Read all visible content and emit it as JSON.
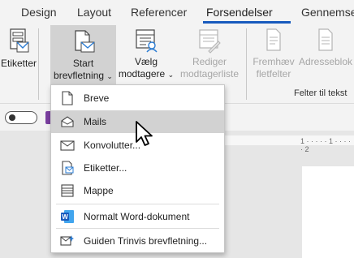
{
  "tabs": [
    {
      "label": "Design"
    },
    {
      "label": "Layout"
    },
    {
      "label": "Referencer"
    },
    {
      "label": "Forsendelser",
      "active": true
    },
    {
      "label": "Gennemse"
    }
  ],
  "ribbon": {
    "etiketter": {
      "line1": "Etiketter",
      "icon": "label-sheet-icon"
    },
    "start": {
      "line1": "Start",
      "line2": "brevfletning",
      "icon": "start-mail-merge-icon"
    },
    "vaelg": {
      "line1": "Vælg",
      "line2": "modtagere",
      "icon": "select-recipients-icon"
    },
    "rediger": {
      "line1": "Rediger",
      "line2": "modtagerliste",
      "icon": "edit-recipient-list-icon"
    },
    "fremhaev": {
      "line1": "Fremhæv",
      "line2": "fletfelter",
      "icon": "highlight-merge-fields-icon"
    },
    "adresseblok": {
      "line1": "Adresseblok",
      "icon": "address-block-icon"
    },
    "group_label": "Felter til tekst"
  },
  "ruler": {
    "marks": "1 · · · · · 1 · · · · · 2"
  },
  "menu": {
    "items": [
      {
        "label": "Breve",
        "icon": "letter-icon"
      },
      {
        "label": "Mails",
        "icon": "email-icon",
        "hover": true
      },
      {
        "label": "Konvolutter...",
        "icon": "envelope-icon"
      },
      {
        "label": "Etiketter...",
        "icon": "labels-icon"
      },
      {
        "label": "Mappe",
        "icon": "directory-icon"
      },
      {
        "label": "Normalt Word-dokument",
        "icon": "word-document-icon"
      },
      {
        "label": "Guiden Trinvis brevfletning...",
        "icon": "wizard-icon"
      }
    ]
  },
  "colors": {
    "accent": "#185abd",
    "hover": "#d2d2d2",
    "disabled": "#a6a6a6"
  }
}
